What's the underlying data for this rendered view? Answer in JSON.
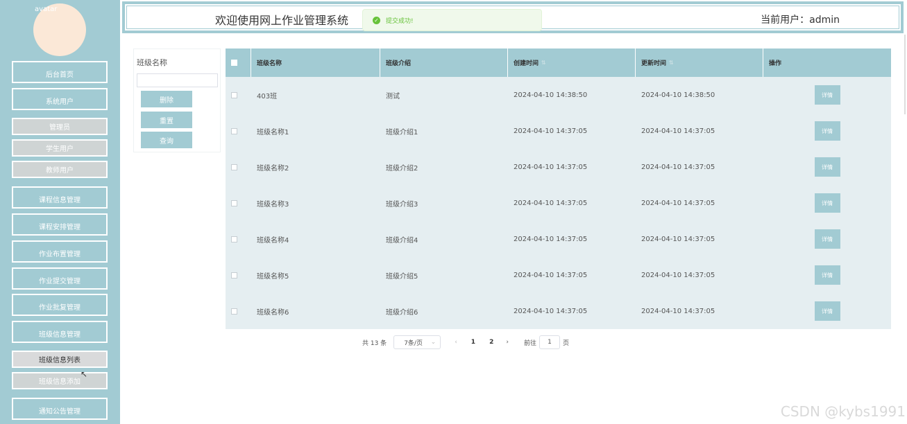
{
  "header": {
    "title": "欢迎使用网上作业管理系统",
    "user_label": "当前用户：admin"
  },
  "toast": {
    "message": "提交成功!"
  },
  "sidebar": {
    "avatar_alt": "avatar",
    "items": [
      {
        "label": "后台首页",
        "type": "main"
      },
      {
        "label": "系统用户",
        "type": "main"
      },
      {
        "label": "管理员",
        "type": "sub"
      },
      {
        "label": "学生用户",
        "type": "sub"
      },
      {
        "label": "教师用户",
        "type": "sub"
      },
      {
        "label": "课程信息管理",
        "type": "main"
      },
      {
        "label": "课程安排管理",
        "type": "main"
      },
      {
        "label": "作业布置管理",
        "type": "main"
      },
      {
        "label": "作业提交管理",
        "type": "main"
      },
      {
        "label": "作业批复管理",
        "type": "main"
      },
      {
        "label": "班级信息管理",
        "type": "main"
      },
      {
        "label": "班级信息列表",
        "type": "sub-active"
      },
      {
        "label": "班级信息添加",
        "type": "sub"
      },
      {
        "label": "通知公告管理",
        "type": "main"
      }
    ]
  },
  "search": {
    "label": "班级名称",
    "value": "",
    "delete_label": "删除",
    "reset_label": "重置",
    "query_label": "查询"
  },
  "table": {
    "headers": [
      "班级名称",
      "班级介绍",
      "创建时间",
      "更新时间",
      "操作"
    ],
    "detail_label": "详情",
    "rows": [
      [
        "403班",
        "测试",
        "2024-04-10 14:38:50",
        "2024-04-10 14:38:50"
      ],
      [
        "班级名称1",
        "班级介绍1",
        "2024-04-10 14:37:05",
        "2024-04-10 14:37:05"
      ],
      [
        "班级名称2",
        "班级介绍2",
        "2024-04-10 14:37:05",
        "2024-04-10 14:37:05"
      ],
      [
        "班级名称3",
        "班级介绍3",
        "2024-04-10 14:37:05",
        "2024-04-10 14:37:05"
      ],
      [
        "班级名称4",
        "班级介绍4",
        "2024-04-10 14:37:05",
        "2024-04-10 14:37:05"
      ],
      [
        "班级名称5",
        "班级介绍5",
        "2024-04-10 14:37:05",
        "2024-04-10 14:37:05"
      ],
      [
        "班级名称6",
        "班级介绍6",
        "2024-04-10 14:37:05",
        "2024-04-10 14:37:05"
      ]
    ]
  },
  "pagination": {
    "total": "共 13 条",
    "page_size": "7条/页",
    "pages": [
      "1",
      "2"
    ],
    "goto_prefix": "前往",
    "goto_value": "1",
    "goto_suffix": "页"
  },
  "watermark": "CSDN @kybs1991"
}
